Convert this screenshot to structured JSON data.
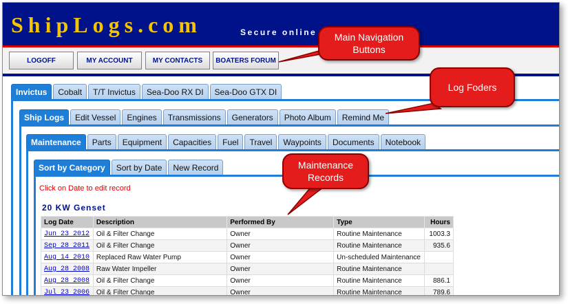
{
  "site": {
    "logo": "ShipLogs.com",
    "tagline": "Secure online log for your boat."
  },
  "nav": {
    "buttons": [
      "LOGOFF",
      "MY ACCOUNT",
      "MY CONTACTS",
      "BOATERS FORUM"
    ]
  },
  "vessel_tabs": {
    "items": [
      "Invictus",
      "Cobalt",
      "T/T Invictus",
      "Sea-Doo RX DI",
      "Sea-Doo GTX DI"
    ],
    "active": "Invictus"
  },
  "folder_tabs": {
    "items": [
      "Ship Logs",
      "Edit Vessel",
      "Engines",
      "Transmissions",
      "Generators",
      "Photo Album",
      "Remind Me"
    ],
    "active": "Ship Logs"
  },
  "log_tabs": {
    "items": [
      "Maintenance",
      "Parts",
      "Equipment",
      "Capacities",
      "Fuel",
      "Travel",
      "Waypoints",
      "Documents",
      "Notebook"
    ],
    "active": "Maintenance"
  },
  "sort_tabs": {
    "items": [
      "Sort by Category",
      "Sort by Date",
      "New Record"
    ],
    "active": "Sort by Category"
  },
  "notice": "Click on Date to edit record",
  "section_title": "20 KW Genset",
  "table": {
    "headers": [
      "Log Date",
      "Description",
      "Performed By",
      "Type",
      "Hours"
    ],
    "rows": [
      [
        "Jun 23 2012",
        "Oil & Filter Change",
        "Owner",
        "Routine Maintenance",
        "1003.3"
      ],
      [
        "Sep 28 2011",
        "Oil & Filter Change",
        "Owner",
        "Routine Maintenance",
        "935.6"
      ],
      [
        "Aug 14 2010",
        "Replaced Raw Water Pump",
        "Owner",
        "Un-scheduled Maintenance",
        ""
      ],
      [
        "Aug 28 2008",
        "Raw Water Impeller",
        "Owner",
        "Routine Maintenance",
        ""
      ],
      [
        "Aug 28 2008",
        "Oil & Filter Change",
        "Owner",
        "Routine Maintenance",
        "886.1"
      ],
      [
        "Jul 23 2006",
        "Oil & Filter Change",
        "Owner",
        "Routine Maintenance",
        "789.6"
      ]
    ]
  },
  "callouts": {
    "nav": "Main Navigation Buttons",
    "folders": "Log Foders",
    "records": "Maintenance Records"
  }
}
